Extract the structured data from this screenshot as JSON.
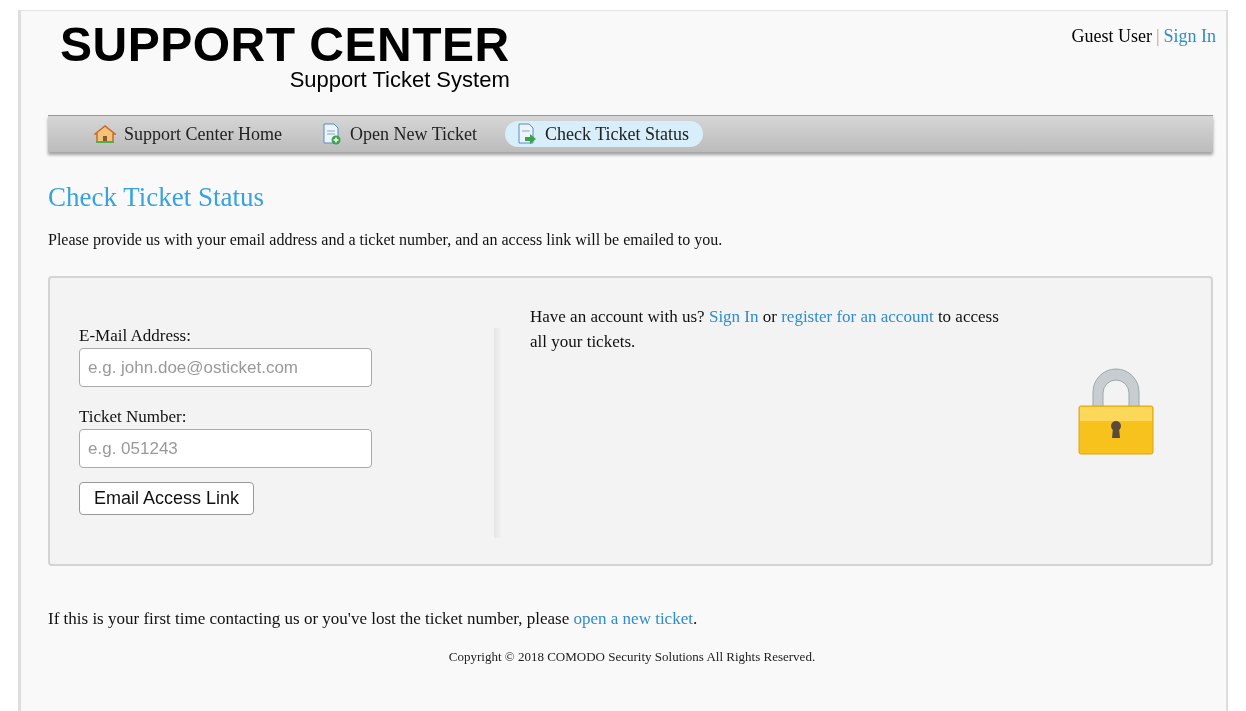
{
  "header": {
    "logo_title": "SUPPORT CENTER",
    "logo_subtitle": "Support Ticket System",
    "user": "Guest User",
    "separator": "|",
    "sign_in": "Sign In"
  },
  "nav": [
    {
      "label": "Support Center Home",
      "kind": "home",
      "selected": false
    },
    {
      "label": "Open New Ticket",
      "kind": "new",
      "selected": false
    },
    {
      "label": "Check Ticket Status",
      "kind": "status",
      "selected": true
    }
  ],
  "heading": "Check Ticket Status",
  "intro": "Please provide us with your email address and a ticket number, and an access link will be emailed to you.",
  "form": {
    "fields": [
      {
        "label": "E-Mail Address:",
        "placeholder": "e.g. john.doe@osticket.com"
      },
      {
        "label": "Ticket Number:",
        "placeholder": "e.g. 051243"
      }
    ],
    "button": "Email Access Link"
  },
  "aside": [
    {
      "kind": "text",
      "text": "Have an account with us? "
    },
    {
      "kind": "link",
      "text": "Sign In"
    },
    {
      "kind": "text",
      "text": " or "
    },
    {
      "kind": "link",
      "text": "register for an account"
    },
    {
      "kind": "text",
      "text": " to access all your tickets."
    }
  ],
  "footer_note": [
    {
      "kind": "text",
      "text": "If this is your first time contacting us or you've lost the ticket number, please "
    },
    {
      "kind": "link",
      "text": "open a new ticket"
    },
    {
      "kind": "text",
      "text": "."
    }
  ],
  "copyright": "Copyright © 2018 COMODO Security Solutions All Rights Reserved."
}
